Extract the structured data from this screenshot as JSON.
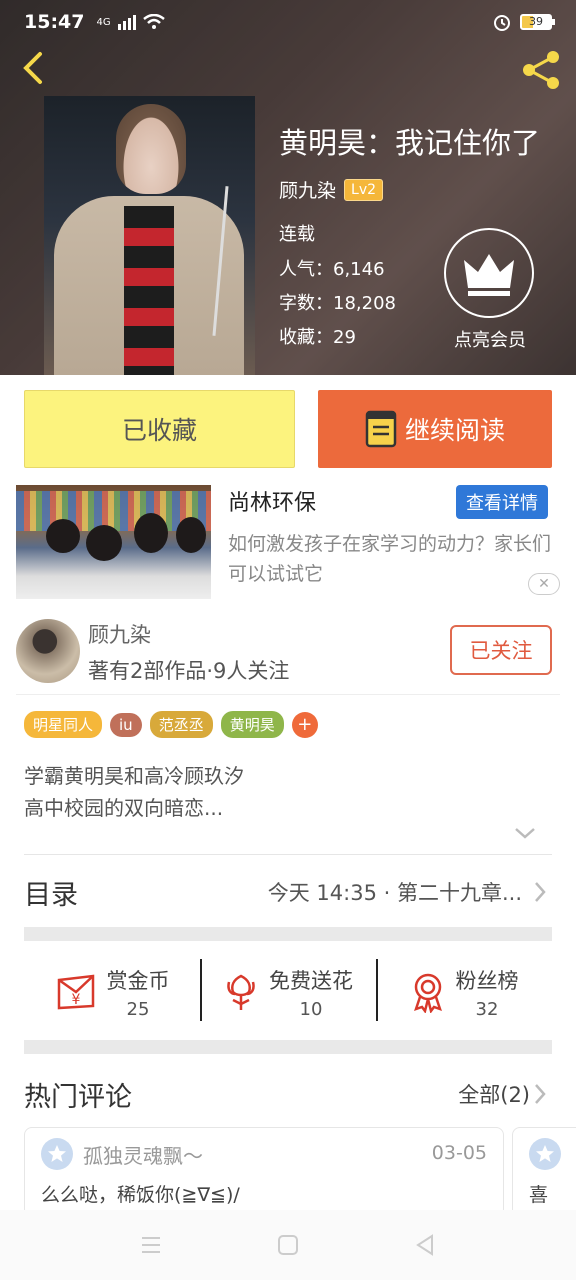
{
  "status_bar": {
    "time": "15:47",
    "network": "4G",
    "battery": "39"
  },
  "book": {
    "title": "黄明昊：我记住你了",
    "author": "顾九染",
    "level": "Lv2",
    "status": "连载",
    "popularity": "人气：6,146",
    "word_count": "字数：18,208",
    "favorites": "收藏：29"
  },
  "vip": {
    "label": "点亮会员"
  },
  "buttons": {
    "collected": "已收藏",
    "continue_reading": "继续阅读"
  },
  "ad": {
    "title": "尚林环保",
    "cta": "查看详情",
    "description": "如何激发孩子在家学习的动力？家长们可以试试它",
    "close": "✕"
  },
  "author_card": {
    "name": "顾九染",
    "stats": "著有2部作品·9人关注",
    "follow": "已关注"
  },
  "tags": [
    {
      "label": "明星同人",
      "color": "#f5b73a"
    },
    {
      "label": "iu",
      "color": "#c0705a"
    },
    {
      "label": "范丞丞",
      "color": "#d8a93a"
    },
    {
      "label": "黄明昊",
      "color": "#8fb64a"
    }
  ],
  "tag_add": "+",
  "synopsis": {
    "line1": "学霸黄明昊和高冷顾玖汐",
    "line2": "高中校园的双向暗恋..."
  },
  "toc": {
    "label": "目录",
    "latest": "今天 14:35 · 第二十九章..."
  },
  "actions": [
    {
      "label": "赏金币",
      "count": "25",
      "icon": "red-envelope-icon"
    },
    {
      "label": "免费送花",
      "count": "10",
      "icon": "flower-icon"
    },
    {
      "label": "粉丝榜",
      "count": "32",
      "icon": "medal-icon"
    }
  ],
  "comments": {
    "title": "热门评论",
    "all": "全部(2)",
    "items": [
      {
        "user": "孤独灵魂飘～",
        "date": "03-05",
        "text": "么么哒，稀饭你(≧∇≦)/"
      },
      {
        "user": "",
        "date": "",
        "text": "喜"
      }
    ]
  },
  "colors": {
    "accent_orange": "#ec6a3c",
    "collected_yellow": "#fcf37e",
    "icon_red": "#d8392b"
  }
}
